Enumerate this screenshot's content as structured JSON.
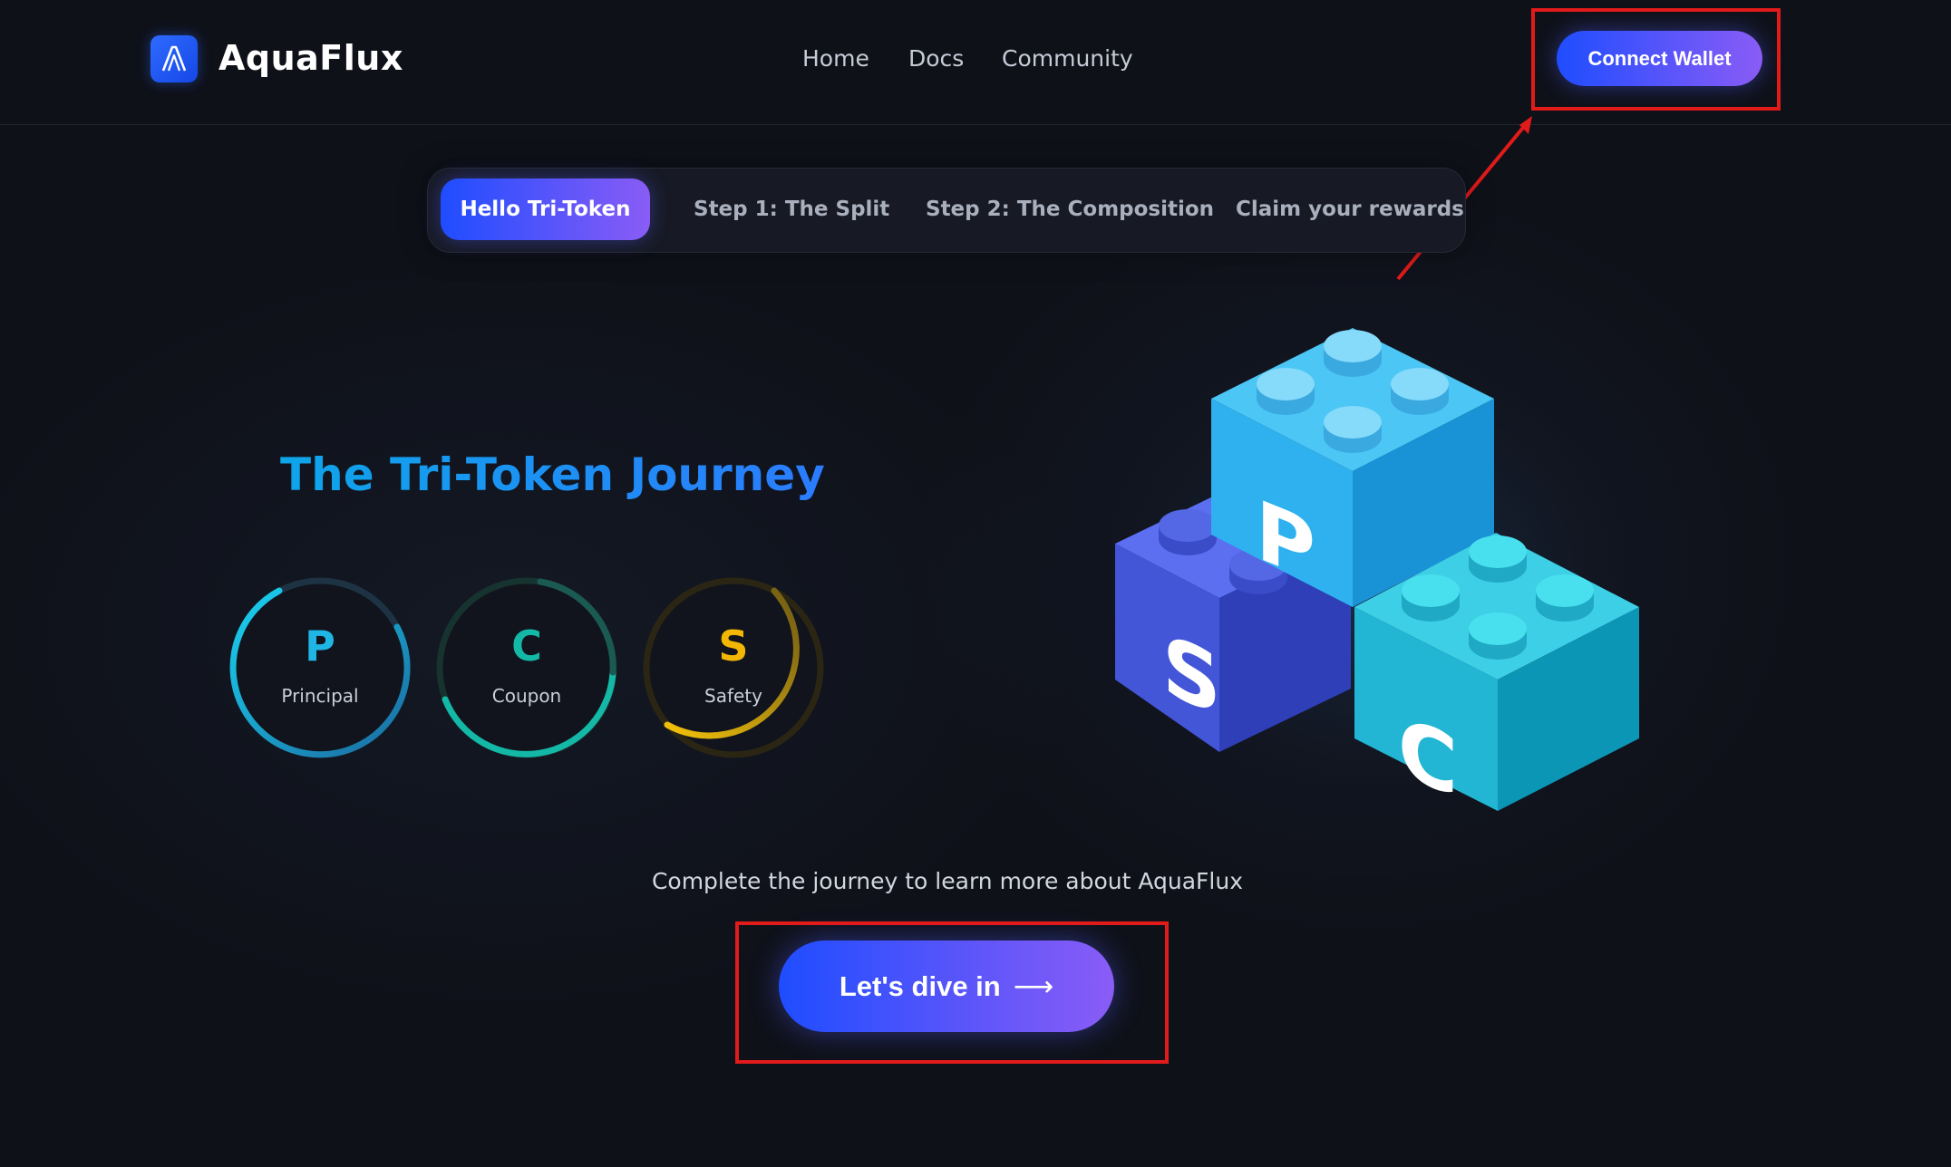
{
  "header": {
    "brand": "AquaFlux",
    "nav": [
      "Home",
      "Docs",
      "Community"
    ],
    "connect_label": "Connect Wallet"
  },
  "tabs": [
    {
      "label": "Hello Tri-Token",
      "active": true
    },
    {
      "label": "Step 1: The Split",
      "active": false
    },
    {
      "label": "Step 2: The Composition",
      "active": false
    },
    {
      "label": "Claim your rewards",
      "active": false
    }
  ],
  "main": {
    "title": "The Tri-Token Journey",
    "tokens": [
      {
        "letter": "P",
        "label": "Principal",
        "color": "#1fb6e6"
      },
      {
        "letter": "C",
        "label": "Coupon",
        "color": "#14b8a6"
      },
      {
        "letter": "S",
        "label": "Safety",
        "color": "#f2b705"
      }
    ],
    "blocks": [
      "P",
      "S",
      "C"
    ],
    "subtitle": "Complete the journey to learn more about AquaFlux",
    "cta_label": "Let's dive in",
    "cta_arrow": "⟶"
  },
  "colors": {
    "background": "#0f1119",
    "accent_start": "#1f4dff",
    "accent_end": "#8a5cf6",
    "highlight": "#e11a1a"
  },
  "icons": {
    "logo": "aquaflux-logo-icon",
    "cta_arrow": "arrow-right-icon"
  }
}
